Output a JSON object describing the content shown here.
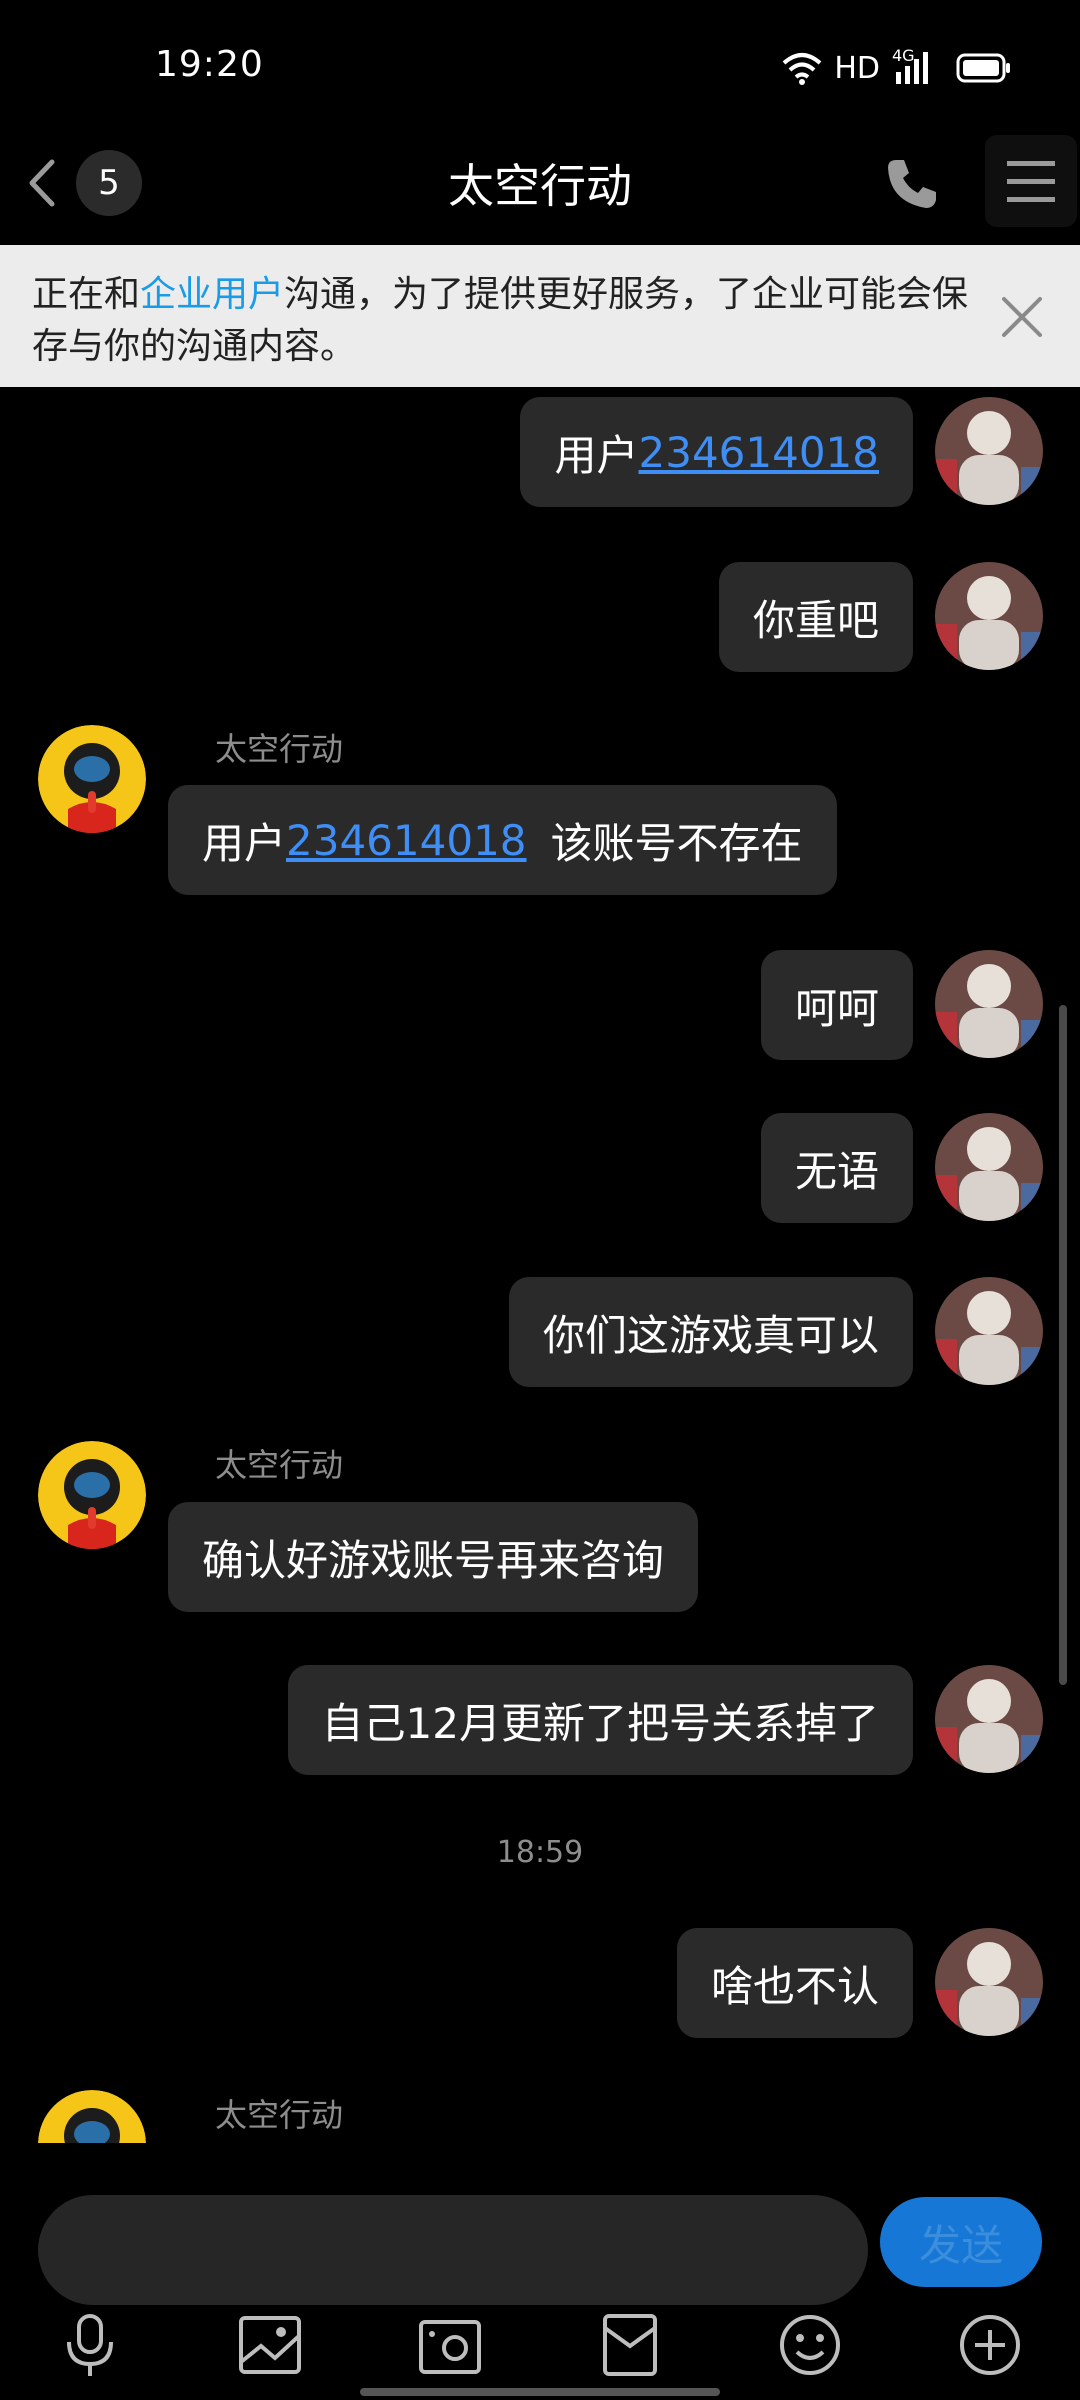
{
  "status_bar": {
    "time": "19:20",
    "network_label": "HD",
    "signal_label": "4G"
  },
  "header": {
    "unread_count": "5",
    "title": "太空行动"
  },
  "notice": {
    "prefix": "正在和",
    "highlight": "企业用户",
    "suffix": "沟通，为了提供更好服务，了企业可能会保存与你的沟通内容。"
  },
  "messages": [
    {
      "side": "me",
      "prefix": "用户",
      "link": "234614018"
    },
    {
      "side": "me",
      "text": "你重吧"
    },
    {
      "side": "bot",
      "sender": "太空行动",
      "prefix": "用户",
      "link": "234614018",
      "suffix": "该账号不存在"
    },
    {
      "side": "me",
      "text": "呵呵"
    },
    {
      "side": "me",
      "text": "无语"
    },
    {
      "side": "me",
      "text": "你们这游戏真可以"
    },
    {
      "side": "bot",
      "sender": "太空行动",
      "text": "确认好游戏账号再来咨询"
    },
    {
      "side": "me",
      "text": "自己12月更新了把号关系掉了"
    },
    {
      "side": "time",
      "text": "18:59"
    },
    {
      "side": "me",
      "text": "啥也不认"
    },
    {
      "side": "bot",
      "sender": "太空行动"
    }
  ],
  "input": {
    "placeholder": "",
    "value": "",
    "send_label": "发送"
  },
  "toolbar": [
    "microphone-icon",
    "image-icon",
    "camera-icon",
    "red-packet-icon",
    "emoji-icon",
    "plus-icon"
  ],
  "colors": {
    "background": "#000000",
    "bubble": "#2a2a2a",
    "link": "#3f8ef5",
    "notice_highlight": "#1a9be8",
    "send_button": "#1677d6"
  }
}
